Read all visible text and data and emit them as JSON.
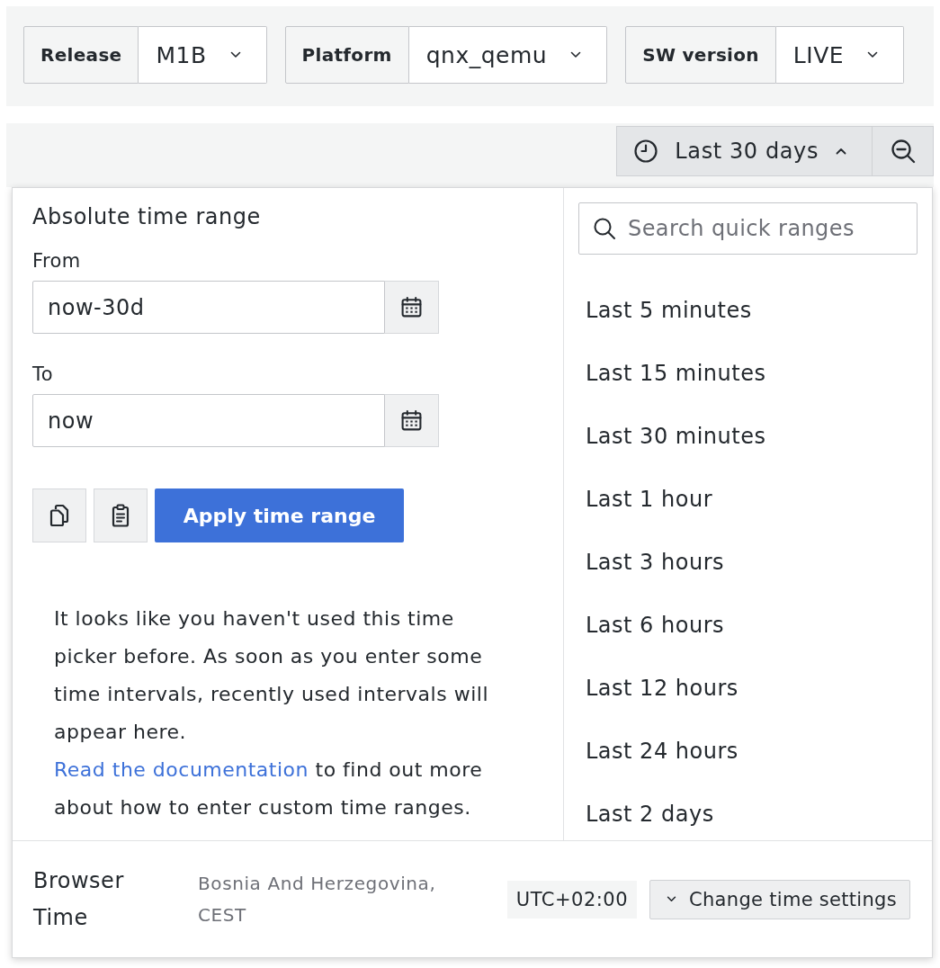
{
  "variables": [
    {
      "label": "Release",
      "value": "M1B"
    },
    {
      "label": "Platform",
      "value": "qnx_qemu"
    },
    {
      "label": "SW version",
      "value": "LIVE"
    }
  ],
  "toolbar": {
    "time_range_button": {
      "label": "Last 30 days",
      "expanded": true
    }
  },
  "time_picker": {
    "absolute_range": {
      "title": "Absolute time range",
      "from": {
        "label": "From",
        "value": "now-30d"
      },
      "to": {
        "label": "To",
        "value": "now"
      },
      "apply_button": "Apply time range"
    },
    "hint": {
      "text": "It looks like you haven't used this time picker before. As soon as you enter some time intervals, recently used intervals will appear here.",
      "link": "Read the documentation",
      "after_link": "to find out more about how to enter custom time ranges."
    },
    "quick_ranges": {
      "search": {
        "placeholder": "Search quick ranges"
      },
      "items": [
        {
          "label": "Last 5 minutes",
          "selected": false
        },
        {
          "label": "Last 15 minutes",
          "selected": false
        },
        {
          "label": "Last 30 minutes",
          "selected": false
        },
        {
          "label": "Last 1 hour",
          "selected": false
        },
        {
          "label": "Last 3 hours",
          "selected": false
        },
        {
          "label": "Last 6 hours",
          "selected": false
        },
        {
          "label": "Last 12 hours",
          "selected": false
        },
        {
          "label": "Last 24 hours",
          "selected": false
        },
        {
          "label": "Last 2 days",
          "selected": false
        }
      ]
    },
    "footer": {
      "label": "Browser Time",
      "timezone": "Bosnia And Herzegovina, CEST",
      "offset": "UTC+02:00",
      "settings_button": "Change time settings"
    }
  }
}
